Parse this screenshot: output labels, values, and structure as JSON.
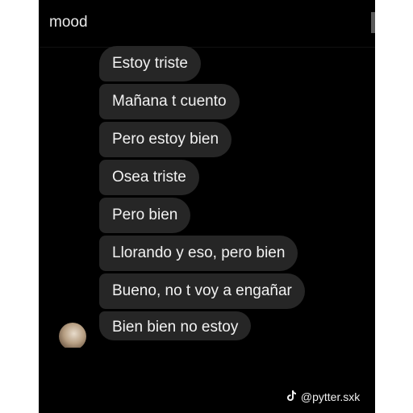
{
  "header": {
    "title": "mood"
  },
  "messages": [
    "Estoy triste",
    "Mañana t cuento",
    "Pero estoy bien",
    "Osea triste",
    "Pero bien",
    "Llorando y eso, pero bien",
    "Bueno, no t voy a engañar",
    "Bien bien no estoy"
  ],
  "watermark": {
    "icon": "tiktok-icon",
    "handle": "@pytter.sxk"
  },
  "colors": {
    "background": "#000000",
    "bubble": "#262626",
    "text": "#f2f2f2"
  }
}
